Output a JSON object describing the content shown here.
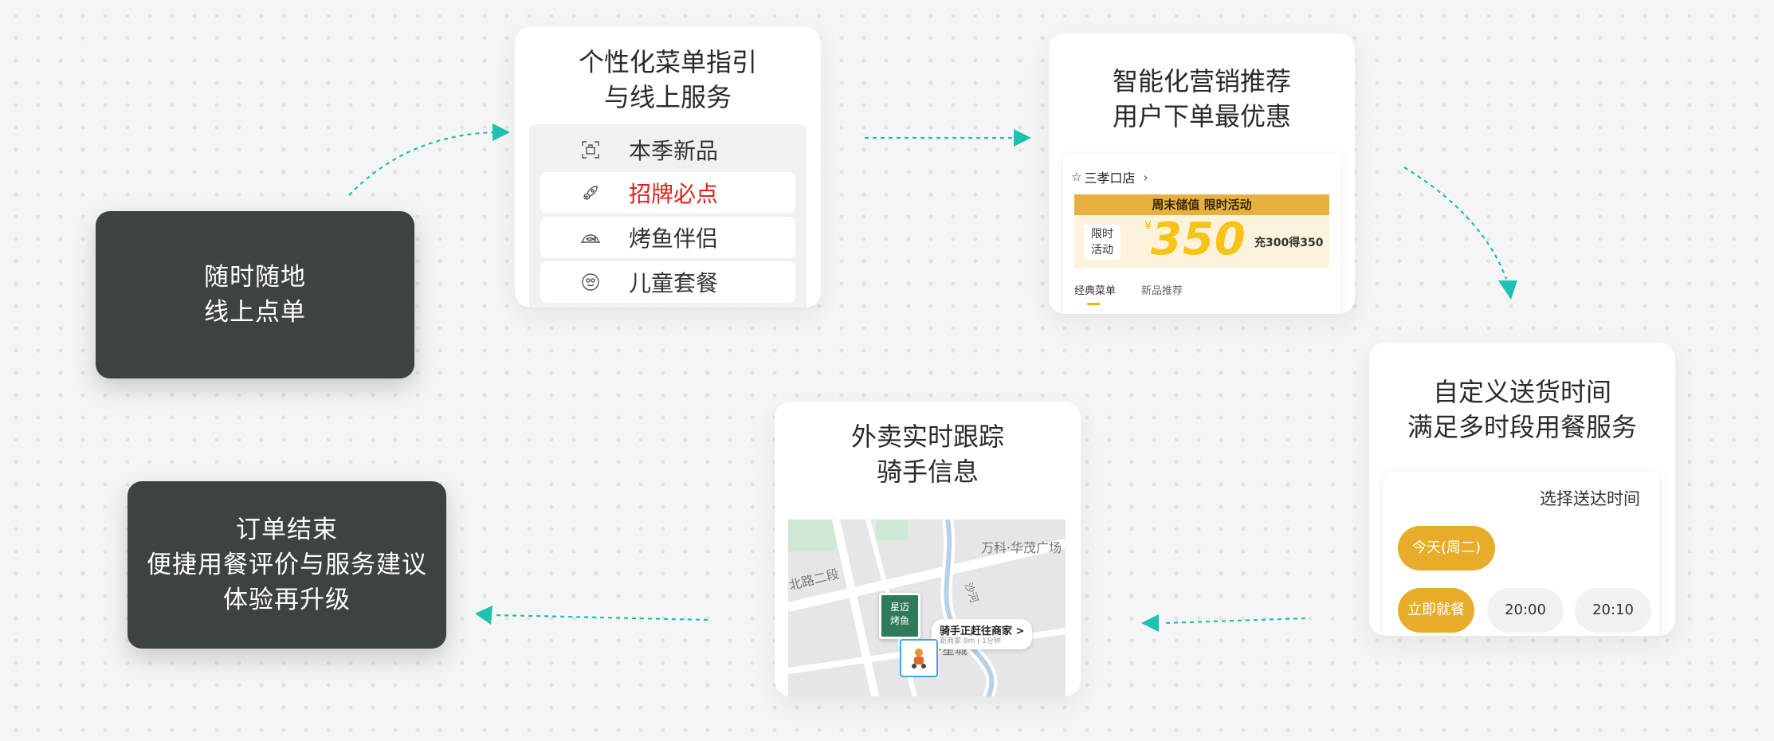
{
  "steps": {
    "order_online": {
      "line1": "随时随地",
      "line2": "线上点单"
    },
    "menu_guide": {
      "title1": "个性化菜单指引",
      "title2": "与线上服务",
      "items": [
        {
          "label": "本季新品",
          "icon": "photo-frame-icon"
        },
        {
          "label": "招牌必点",
          "icon": "rocket-icon",
          "color": "#e02020"
        },
        {
          "label": "烤鱼伴侣",
          "icon": "fish-plate-icon"
        },
        {
          "label": "儿童套餐",
          "icon": "kids-meal-icon"
        }
      ]
    },
    "smart_marketing": {
      "title1": "智能化营销推荐",
      "title2": "用户下单最优惠",
      "store": "三孝口店",
      "banner": "周末储值 限时活动",
      "badge_line1": "限时",
      "badge_line2": "活动",
      "currency": "¥",
      "amount": "350",
      "offer": "充300得350",
      "tabs": [
        "经典菜单",
        "新品推荐"
      ]
    },
    "delivery_time": {
      "title1": "自定义送货时间",
      "title2": "满足多时段用餐服务",
      "select_label": "选择送达时间",
      "day": "今天(周二)",
      "slots": [
        "立即就餐",
        "20:00",
        "20:10"
      ]
    },
    "tracking": {
      "title1": "外卖实时跟踪",
      "title2": "骑手信息",
      "store_pin1": "星迈",
      "store_pin2": "烤鱼",
      "rider_status": "骑手正赶往商家 >",
      "rider_sub": "距商家 8m | 1分钟",
      "road": "北路二段",
      "plaza": "万科·华茂广场",
      "river": "沙河",
      "area": "州·星城"
    },
    "order_end": {
      "line1": "订单结束",
      "line2": "便捷用餐评价与服务建议",
      "line3": "体验再升级"
    }
  },
  "colors": {
    "arrow": "#1ec2b0",
    "dark_box": "#3d4341",
    "accent": "#e8ac2b",
    "highlight_red": "#e02020"
  }
}
